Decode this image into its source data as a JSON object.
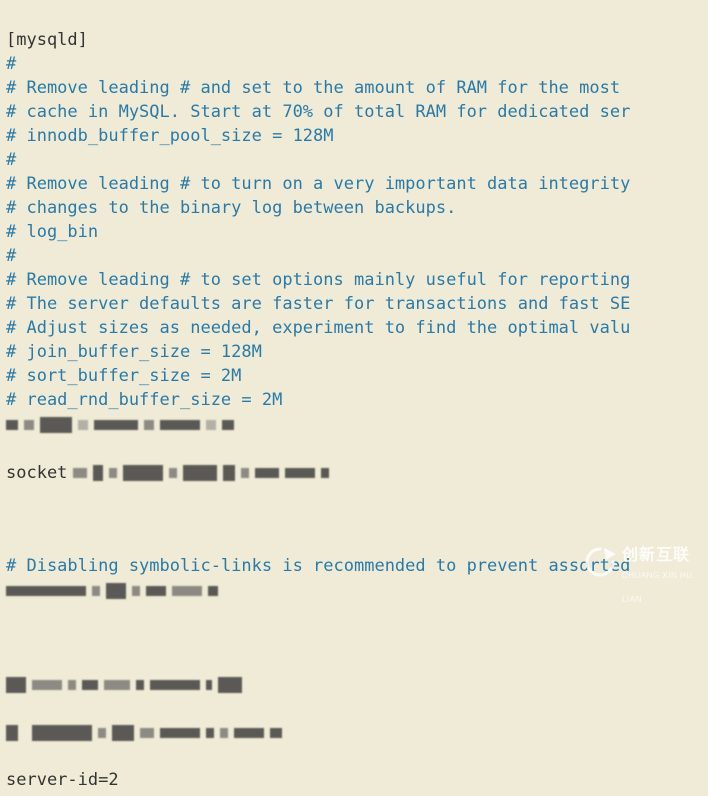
{
  "brand": "[mysqld]",
  "lines": {
    "l01": "#",
    "l02": "# Remove leading # and set to the amount of RAM for the most",
    "l03": "# cache in MySQL. Start at 70% of total RAM for dedicated ser",
    "l04": "# innodb_buffer_pool_size = 128M",
    "l05": "#",
    "l06": "# Remove leading # to turn on a very important data integrity",
    "l07": "# changes to the binary log between backups.",
    "l08": "# log_bin",
    "l09": "#",
    "l10": "# Remove leading # to set options mainly useful for reporting",
    "l11": "# The server defaults are faster for transactions and fast SE",
    "l12": "# Adjust sizes as needed, experiment to find the optimal valu",
    "l13": "# join_buffer_size = 128M",
    "l14": "# sort_buffer_size = 2M",
    "l15": "# read_rnd_buffer_size = 2M",
    "socket_label": "socket",
    "symlink_line": "# Disabling symbolic-links is recommended to prevent assorted",
    "serverid_line": "server-id=2"
  },
  "watermark": {
    "cn": "创新互联",
    "en": "CHUANG XIN HU LIAN"
  }
}
